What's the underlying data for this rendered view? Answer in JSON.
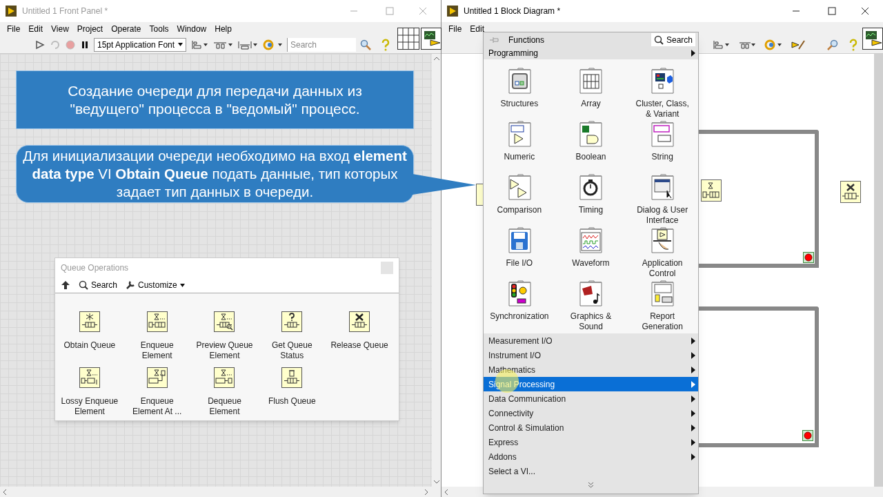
{
  "front_panel": {
    "title": "Untitled 1 Front Panel *",
    "menu": [
      "File",
      "Edit",
      "View",
      "Project",
      "Operate",
      "Tools",
      "Window",
      "Help"
    ],
    "font_dropdown": "15pt Application Font",
    "search": {
      "placeholder": "Search"
    }
  },
  "callouts": [
    {
      "text": "Создание очереди для передачи данных из \"ведущего\" процесса в \"ведомый\" процесс."
    },
    {
      "text": "Для инициализации очереди необходимо на вход **element data type** VI **Obtain Queue** подать данные, тип которых задает тип данных в очереди."
    }
  ],
  "queue_palette": {
    "title": "Queue Operations",
    "search": "Search",
    "customize": "Customize",
    "items": [
      "Obtain Queue",
      "Enqueue Element",
      "Preview Queue Element",
      "Get Queue Status",
      "Release Queue",
      "Lossy Enqueue Element",
      "Enqueue Element At ...",
      "Dequeue Element",
      "Flush Queue"
    ]
  },
  "block_diagram": {
    "title": "Untitled 1 Block Diagram *",
    "menu": [
      "File",
      "Edit"
    ]
  },
  "functions_palette": {
    "title": "Functions",
    "search": "Search",
    "category": "Programming",
    "items": [
      "Structures",
      "Array",
      "Cluster, Class, & Variant",
      "Numeric",
      "Boolean",
      "String",
      "Comparison",
      "Timing",
      "Dialog & User Interface",
      "File I/O",
      "Waveform",
      "Application Control",
      "Synchronization",
      "Graphics & Sound",
      "Report Generation"
    ],
    "menu": [
      {
        "label": "Measurement I/O",
        "selected": false,
        "submenu": true
      },
      {
        "label": "Instrument I/O",
        "selected": false,
        "submenu": true
      },
      {
        "label": "Mathematics",
        "selected": false,
        "submenu": true
      },
      {
        "label": "Signal Processing",
        "selected": true,
        "submenu": true
      },
      {
        "label": "Data Communication",
        "selected": false,
        "submenu": true
      },
      {
        "label": "Connectivity",
        "selected": false,
        "submenu": true
      },
      {
        "label": "Control & Simulation",
        "selected": false,
        "submenu": true
      },
      {
        "label": "Express",
        "selected": false,
        "submenu": true
      },
      {
        "label": "Addons",
        "selected": false,
        "submenu": true
      },
      {
        "label": "Select a VI...",
        "selected": false,
        "submenu": false
      }
    ]
  }
}
